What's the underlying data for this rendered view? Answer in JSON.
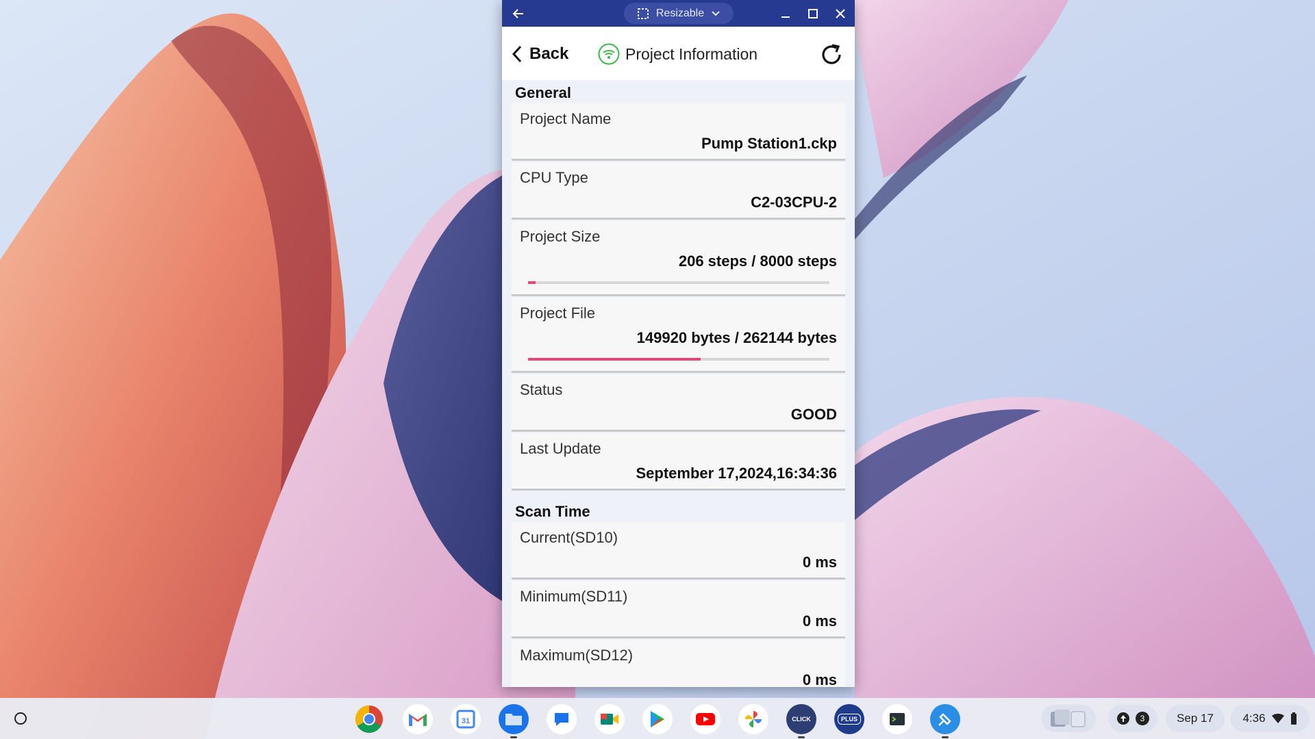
{
  "window": {
    "titlebar": {
      "mode_label": "Resizable"
    },
    "appbar": {
      "back_label": "Back",
      "title": "Project Information"
    },
    "sections": [
      {
        "title": "General",
        "items": [
          {
            "label": "Project Name",
            "value": "Pump Station1.ckp"
          },
          {
            "label": "CPU Type",
            "value": "C2-03CPU-2"
          },
          {
            "label": "Project Size",
            "value": "206 steps / 8000 steps",
            "progress": 0.026
          },
          {
            "label": "Project File",
            "value": "149920 bytes / 262144 bytes",
            "progress": 0.572
          },
          {
            "label": "Status",
            "value": "GOOD"
          },
          {
            "label": "Last Update",
            "value": "September 17,2024,16:34:36"
          }
        ]
      },
      {
        "title": "Scan Time",
        "items": [
          {
            "label": "Current(SD10)",
            "value": "0 ms"
          },
          {
            "label": "Minimum(SD11)",
            "value": "0 ms"
          },
          {
            "label": "Maximum(SD12)",
            "value": "0 ms"
          }
        ]
      }
    ]
  },
  "shelf": {
    "apps": [
      "chrome-icon",
      "gmail-icon",
      "calendar-icon",
      "files-icon",
      "messages-icon",
      "meet-icon",
      "play-store-icon",
      "youtube-icon",
      "photos-icon",
      "click-programming-icon",
      "click-plus-icon",
      "terminal-icon",
      "connect-app-icon"
    ],
    "calendar_day": "31",
    "click_label": "CLICK",
    "plus_label": "PLUS",
    "notification_count": "3",
    "date": "Sep 17",
    "time": "4:36"
  },
  "colors": {
    "titlebar": "#263a92",
    "progress_fill": "#e8457a",
    "wifi_icon": "#3cb84a"
  }
}
